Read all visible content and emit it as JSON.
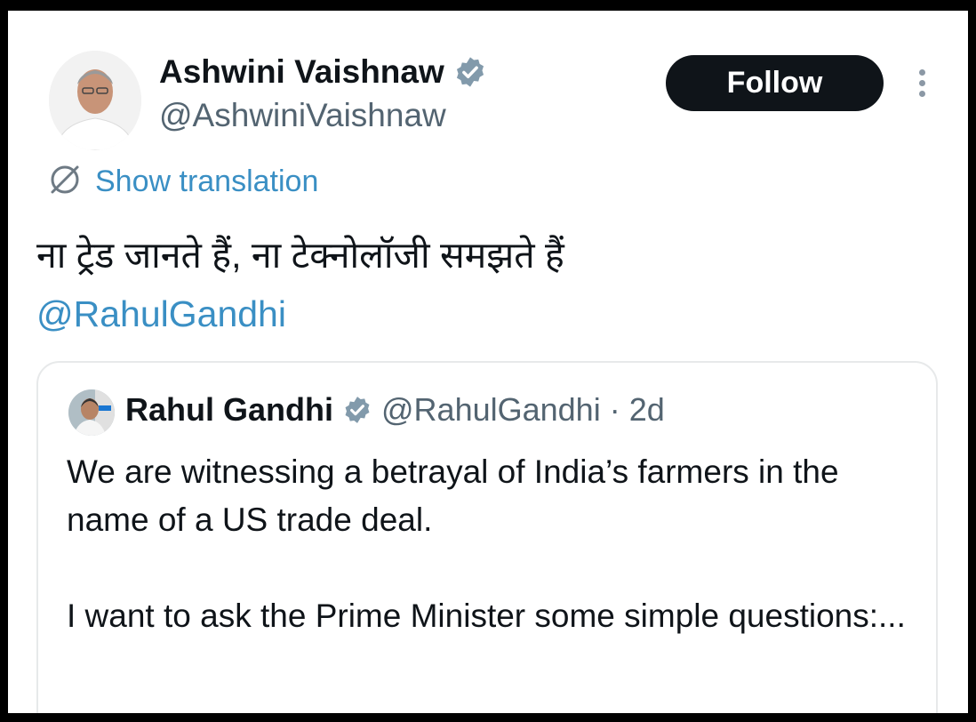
{
  "tweet": {
    "author_name": "Ashwini Vaishnaw",
    "author_handle": "@AshwiniVaishnaw",
    "follow_label": "Follow",
    "show_translation_label": "Show translation",
    "text": "ना ट्रेड जानते हैं, ना टेक्नोलॉजी समझते हैं",
    "mention": "@RahulGandhi"
  },
  "quote": {
    "author_name": "Rahul Gandhi",
    "author_handle": "@RahulGandhi",
    "separator": "·",
    "time": "2d",
    "text_line1": "We are witnessing a betrayal of India’s farmers in the name of a US trade deal.",
    "text_line2": "I want to ask the Prime Minister some simple questions:..."
  },
  "colors": {
    "link": "#3a8fc4",
    "verified_badge": "#829aab",
    "follow_bg": "#0f1419"
  },
  "icons": {
    "verified": "verified-badge-icon",
    "translate": "translate-icon",
    "more": "more-options-icon"
  }
}
